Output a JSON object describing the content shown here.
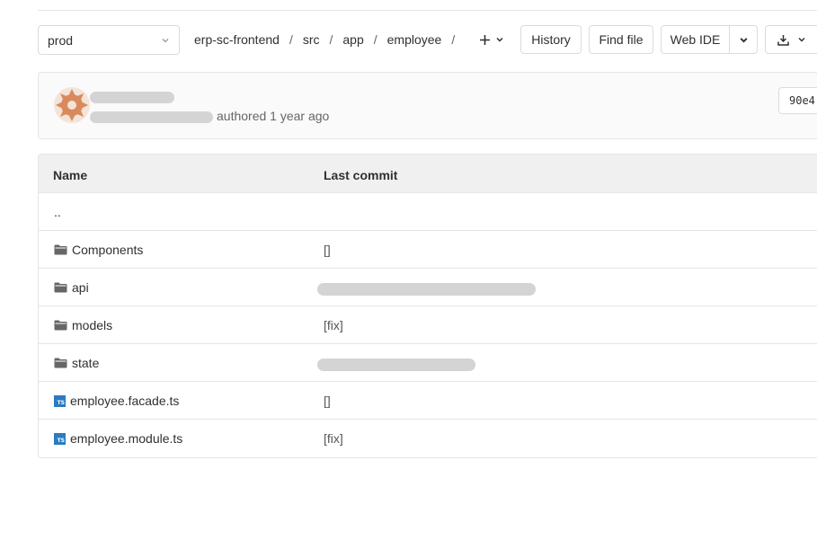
{
  "branch": {
    "selected": "prod"
  },
  "breadcrumb": {
    "parts": [
      "erp-sc-frontend",
      "src",
      "app",
      "employee"
    ],
    "separator": "/"
  },
  "toolbar": {
    "history_label": "History",
    "find_file_label": "Find file",
    "web_ide_label": "Web IDE"
  },
  "commit": {
    "authored_text": "authored 1 year ago",
    "sha_short": "90e4"
  },
  "table": {
    "headers": {
      "name": "Name",
      "last_commit": "Last commit"
    },
    "rows": [
      {
        "type": "parent",
        "name": "..",
        "message": ""
      },
      {
        "type": "folder",
        "name": "Components",
        "message": "[]"
      },
      {
        "type": "folder",
        "name": "api",
        "message": ""
      },
      {
        "type": "folder",
        "name": "models",
        "message": "[fix]"
      },
      {
        "type": "folder",
        "name": "state",
        "message": ""
      },
      {
        "type": "ts-file",
        "name": "employee.facade.ts",
        "message": "[]"
      },
      {
        "type": "ts-file",
        "name": "employee.module.ts",
        "message": "[fix]"
      }
    ]
  },
  "colors": {
    "avatar": "#d98a5c",
    "ts_icon": "#2b7bbf",
    "border": "#dbdbdb"
  }
}
